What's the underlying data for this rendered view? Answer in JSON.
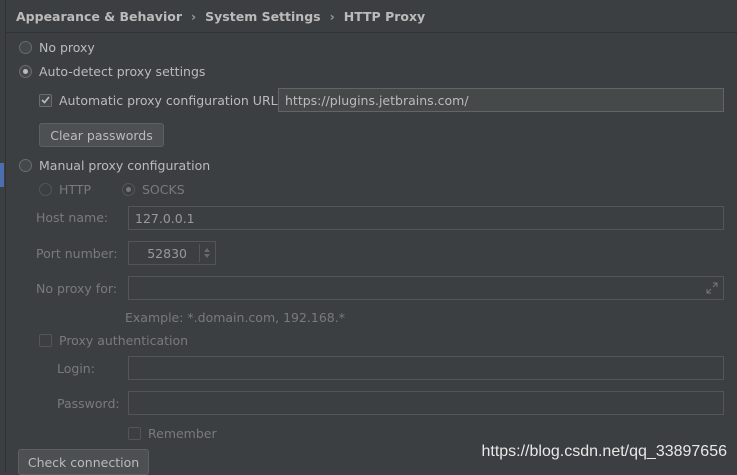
{
  "breadcrumb": [
    "Appearance & Behavior",
    "System Settings",
    "HTTP Proxy"
  ],
  "options": {
    "no_proxy": "No proxy",
    "auto_detect": "Auto-detect proxy settings",
    "auto_config_url_label": "Automatic proxy configuration URL:",
    "auto_config_url_value": "https://plugins.jetbrains.com/",
    "clear_passwords": "Clear passwords",
    "manual": "Manual proxy configuration"
  },
  "manual": {
    "http": "HTTP",
    "socks": "SOCKS",
    "host_label": "Host name:",
    "host_value": "127.0.0.1",
    "port_label": "Port number:",
    "port_value": "52830",
    "no_proxy_label": "No proxy for:",
    "no_proxy_value": "",
    "example": "Example: *.domain.com, 192.168.*",
    "proxy_auth": "Proxy authentication",
    "login_label": "Login:",
    "login_value": "",
    "password_label": "Password:",
    "password_value": "",
    "remember": "Remember"
  },
  "check_connection": "Check connection",
  "watermark": "https://blog.csdn.net/qq_33897656",
  "state": {
    "selected_mode": "auto_detect",
    "auto_config_url_checked": true,
    "selected_protocol": "socks"
  }
}
